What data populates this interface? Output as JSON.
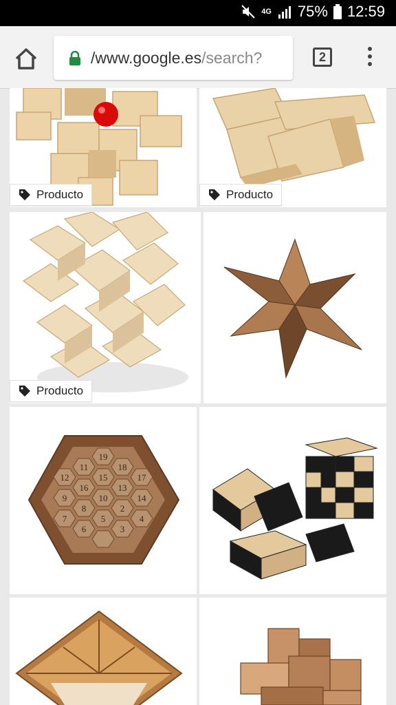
{
  "status": {
    "network": "4G",
    "battery": "75%",
    "time": "12:59"
  },
  "toolbar": {
    "url_host": "/www.google.es",
    "url_path": "/search?",
    "tab_count": "2"
  },
  "results": {
    "badge_label": "Producto",
    "puzzles": [
      "burr-puzzle-red-ball",
      "interlocking-cube-puzzle",
      "spiked-burr-puzzle",
      "wooden-star-puzzle",
      "hexagon-number-puzzle",
      "black-white-cube-puzzle",
      "tangram-square-puzzle",
      "block-stack-puzzle"
    ],
    "hex_numbers": [
      "19",
      "11",
      "18",
      "12",
      "15",
      "17",
      "16",
      "13",
      "9",
      "10",
      "14",
      "8",
      "2",
      "7",
      "5",
      "4",
      "6",
      "3"
    ]
  },
  "colors": {
    "light_wood": "#e8cfa6",
    "dark_wood": "#8a5a36",
    "red_ball": "#d90a0a"
  }
}
